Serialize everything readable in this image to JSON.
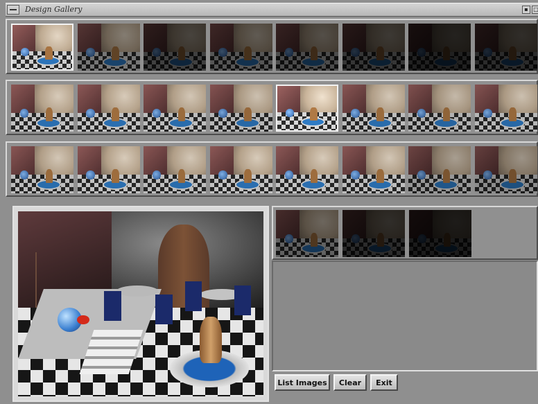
{
  "window": {
    "title": "Design Gallery",
    "menu_icon": "window-menu-icon",
    "minimize_icon": "minimize-icon",
    "maximize_icon": "maximize-icon"
  },
  "gallery": {
    "row_count": 3,
    "thumbs_per_row": 8,
    "selected": {
      "row1": 1,
      "row2": 5,
      "row3": null
    }
  },
  "buttons": {
    "list_images": "List Images",
    "clear": "Clear",
    "exit": "Exit"
  }
}
